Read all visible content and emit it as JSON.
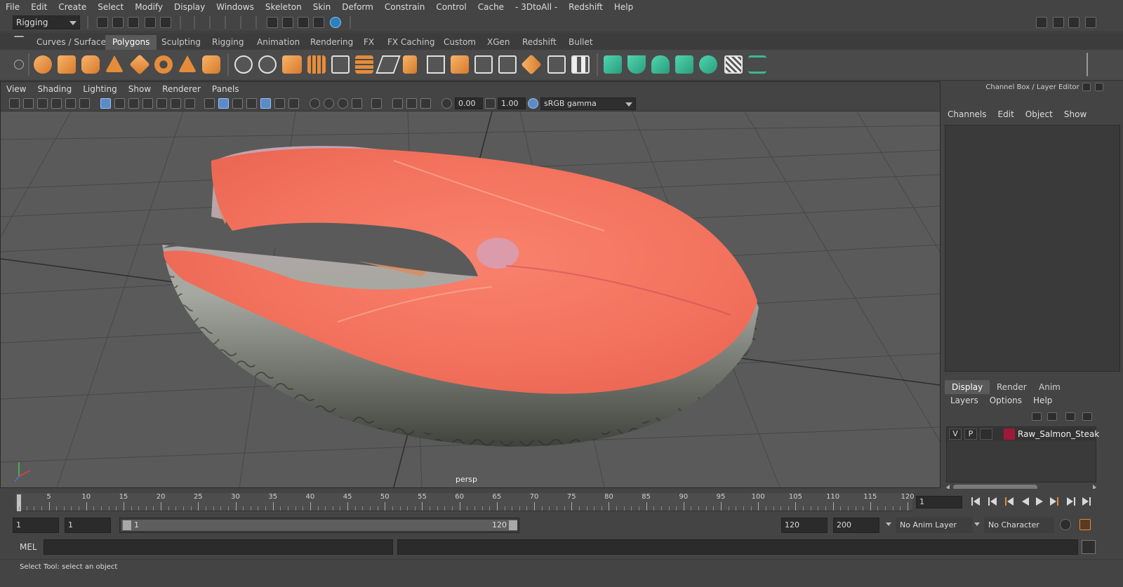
{
  "menubar": {
    "items": [
      "File",
      "Edit",
      "Create",
      "Select",
      "Modify",
      "Display",
      "Windows",
      "Skeleton",
      "Skin",
      "Deform",
      "Constrain",
      "Control",
      "Cache",
      "- 3DtoAll -",
      "Redshift",
      "Help"
    ]
  },
  "statusline": {
    "mode": "Rigging"
  },
  "shelf": {
    "tabs": [
      "Curves / Surfaces",
      "Polygons",
      "Sculpting",
      "Rigging",
      "Animation",
      "Rendering",
      "FX",
      "FX Caching",
      "Custom",
      "XGen",
      "Redshift",
      "Bullet"
    ],
    "active_tab": "Polygons"
  },
  "viewport": {
    "menu": [
      "View",
      "Shading",
      "Lighting",
      "Show",
      "Renderer",
      "Panels"
    ],
    "exposure": "0.00",
    "gamma": "1.00",
    "color_space": "sRGB gamma",
    "camera_label": "persp"
  },
  "channel_box": {
    "title": "Channel Box / Layer Editor",
    "menu": [
      "Channels",
      "Edit",
      "Object",
      "Show"
    ]
  },
  "layer_editor": {
    "tabs": [
      "Display",
      "Render",
      "Anim"
    ],
    "active_tab": "Display",
    "menu": [
      "Layers",
      "Options",
      "Help"
    ],
    "layers": [
      {
        "visible": "V",
        "playback": "P",
        "color": "#a01837",
        "name": "Raw_Salmon_Steak"
      }
    ]
  },
  "timeline": {
    "tick_labels": [
      "5",
      "10",
      "15",
      "20",
      "25",
      "30",
      "35",
      "40",
      "45",
      "50",
      "55",
      "60",
      "65",
      "70",
      "75",
      "80",
      "85",
      "90",
      "95",
      "100",
      "105",
      "110",
      "115",
      "120"
    ],
    "playhead_label": "1",
    "current_frame": "1"
  },
  "range": {
    "start": "1",
    "playback_start": "1",
    "slider_start": "1",
    "slider_end": "120",
    "playback_end": "120",
    "end": "200",
    "anim_layer": "No Anim Layer",
    "character_set": "No Character Set"
  },
  "command_line": {
    "label": "MEL"
  },
  "help_line": {
    "text": "Select Tool: select an object"
  },
  "colors": {
    "background": "#444444",
    "viewport_bg": "#5a5a5a",
    "layer_color": "#a01837",
    "shelf_orange": "#e58c3a",
    "shelf_green": "#3bb894"
  }
}
